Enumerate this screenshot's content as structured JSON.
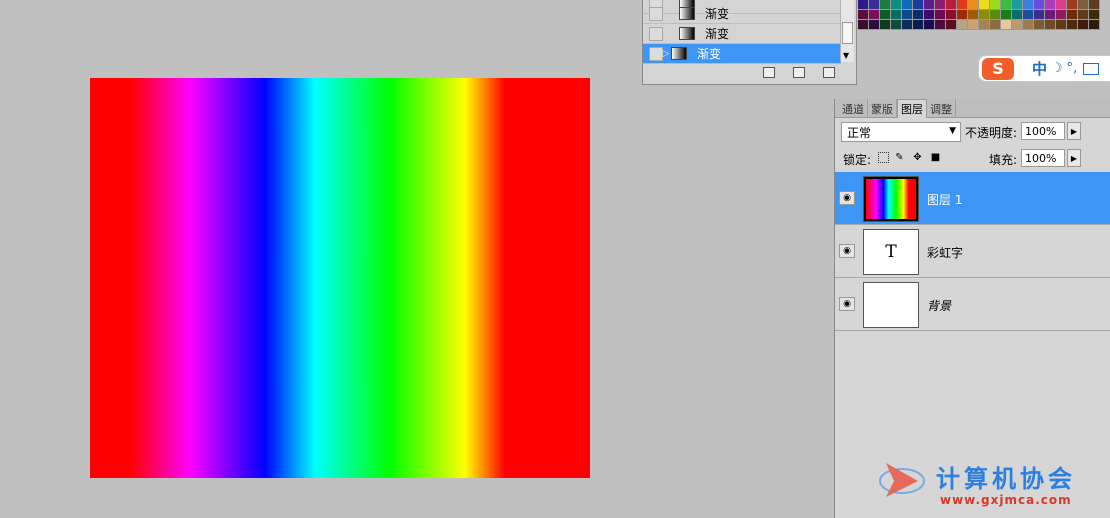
{
  "canvas": {
    "content": "rainbow-gradient"
  },
  "history": {
    "items": [
      {
        "label": "渐变",
        "selected": false
      },
      {
        "label": "渐变",
        "selected": false
      },
      {
        "label": "渐变",
        "selected": true
      }
    ],
    "footer_icons": [
      "new-document-icon",
      "camera-icon",
      "trash-icon"
    ]
  },
  "ime": {
    "logo": "S",
    "lang": "中",
    "moon": "☽",
    "punct": "°,"
  },
  "layers_panel": {
    "tabs": [
      {
        "label": "通道",
        "active": false
      },
      {
        "label": "蒙版",
        "active": false
      },
      {
        "label": "图层",
        "active": true
      },
      {
        "label": "调整",
        "active": false
      }
    ],
    "blend_mode": "正常",
    "opacity_label": "不透明度:",
    "opacity_value": "100%",
    "lock_label": "锁定:",
    "fill_label": "填充:",
    "fill_value": "100%",
    "layers": [
      {
        "name": "图层 1",
        "thumb": "rainbow",
        "selected": true
      },
      {
        "name": "彩虹字",
        "thumb": "text",
        "thumb_label": "T",
        "selected": false
      },
      {
        "name": "背景",
        "thumb": "white",
        "selected": false
      }
    ]
  },
  "watermark": {
    "name": "计算机协会",
    "url": "www.gxjmca.com"
  },
  "colors": {
    "selection": "#3d95f5",
    "panel": "#d6d6d6",
    "workspace": "#c0c0c0"
  }
}
